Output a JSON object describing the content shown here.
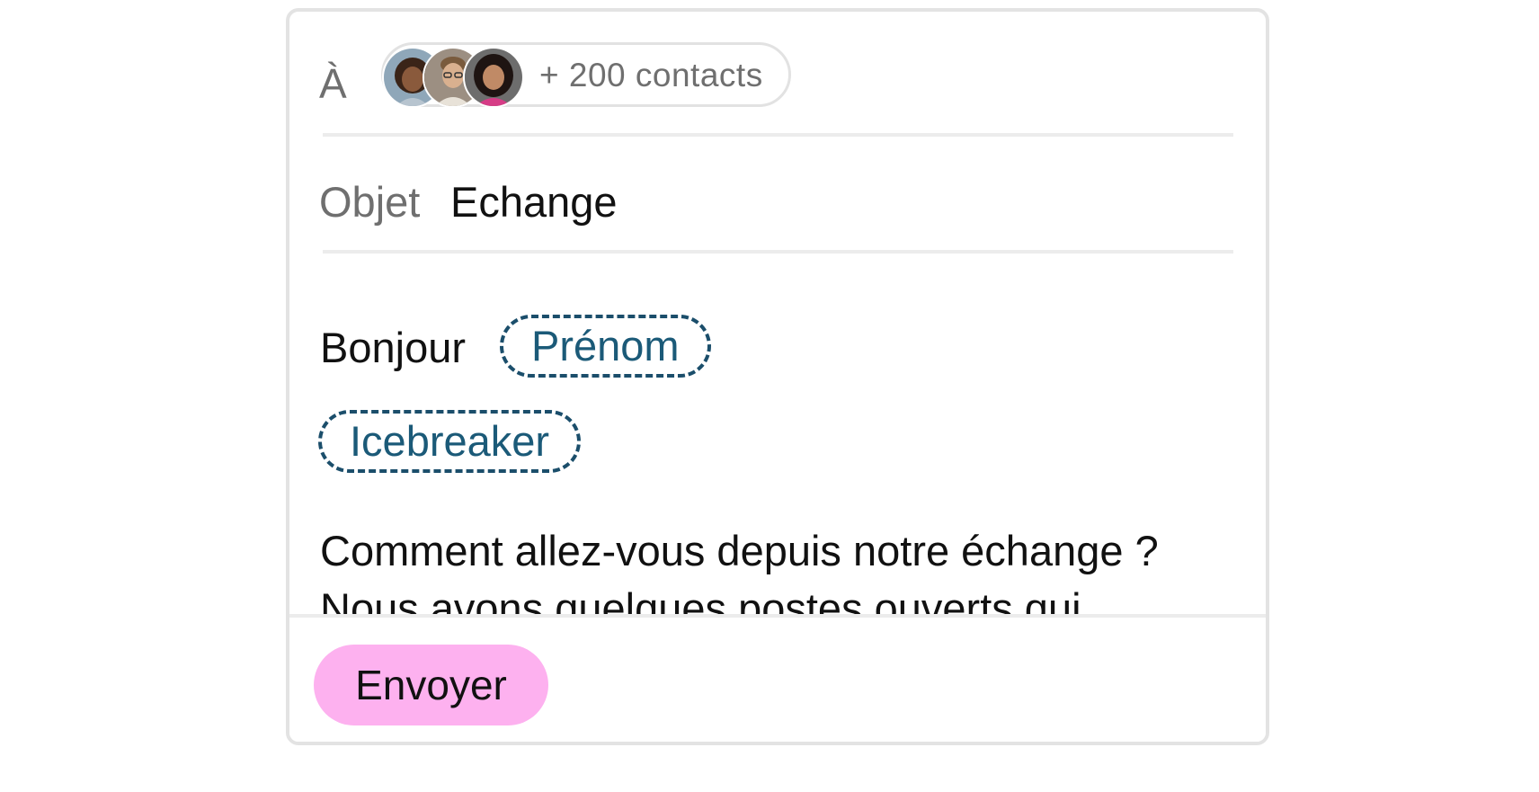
{
  "recipients": {
    "label": "À",
    "count_text": "+ 200 contacts",
    "avatars": [
      "avatar-woman-curly-hair",
      "avatar-man-glasses",
      "avatar-woman-dark-hair"
    ]
  },
  "subject": {
    "label": "Objet",
    "value": "Echange"
  },
  "message": {
    "greeting": "Bonjour",
    "variable_firstname": "Prénom",
    "variable_icebreaker": "Icebreaker",
    "body": "Comment allez-vous depuis notre échange ? Nous avons quelques postes ouverts qui"
  },
  "actions": {
    "send_label": "Envoyer"
  },
  "colors": {
    "send_button": "#fdb1ef",
    "variable_chip": "#1b5a78",
    "border": "#e3e3e3"
  }
}
